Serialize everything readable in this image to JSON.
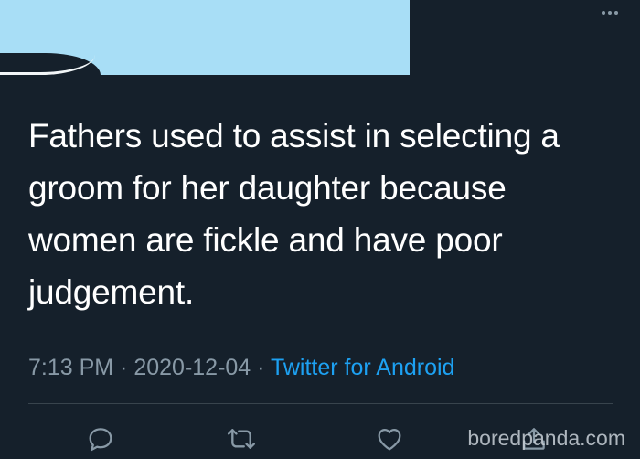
{
  "tweet": {
    "text": "Fathers used to assist in selecting a\ngroom for her daughter because\nwomen are fickle and have poor\njudgement.",
    "time": "7:13 PM",
    "separator": " · ",
    "date": "2020-12-04",
    "source": "Twitter for Android"
  },
  "actions": [
    {
      "icon": "reply-icon"
    },
    {
      "icon": "retweet-icon"
    },
    {
      "icon": "like-icon"
    },
    {
      "icon": "share-icon"
    }
  ],
  "watermark": "boredpanda.com",
  "colors": {
    "background": "#15202b",
    "text": "#ffffff",
    "muted": "#8899a6",
    "link": "#1da1f2",
    "redaction": "#a8def6"
  }
}
